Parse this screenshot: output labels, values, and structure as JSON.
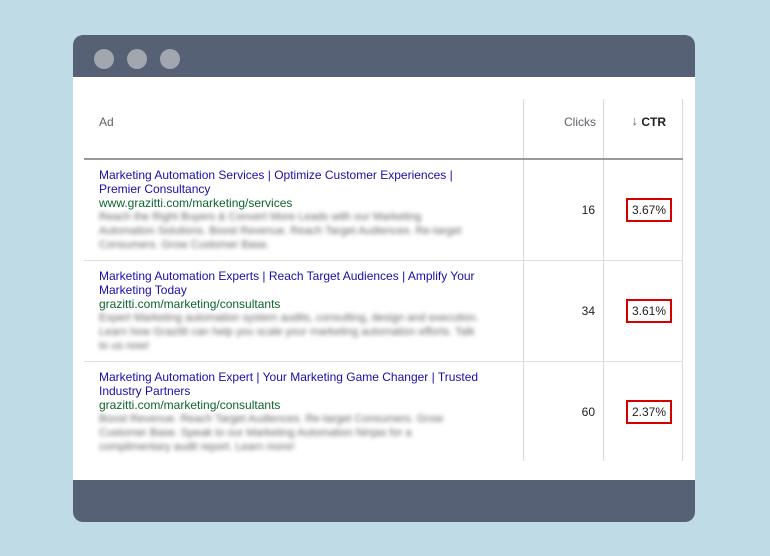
{
  "table": {
    "headers": {
      "ad": "Ad",
      "clicks": "Clicks",
      "ctr": "CTR"
    },
    "sort_icon": "arrow-down-icon",
    "rows": [
      {
        "title_line1": "Marketing Automation Services | Optimize Customer Experiences |",
        "title_line2": "Premier Consultancy",
        "url": "www.grazitti.com/marketing/services",
        "desc": "Reach the Right Buyers & Convert More Leads with our Marketing Automation Solutions. Boost Revenue. Reach Target Audiences. Re-target Consumers. Grow Customer Base.",
        "clicks": "16",
        "ctr": "3.67%"
      },
      {
        "title_line1": "Marketing Automation Experts | Reach Target Audiences | Amplify Your",
        "title_line2": "Marketing Today",
        "url": "grazitti.com/marketing/consultants",
        "desc": "Expert Marketing automation system audits, consulting, design and execution. Learn how Grazitti can help you scale your marketing automation efforts. Talk to us now!",
        "clicks": "34",
        "ctr": "3.61%"
      },
      {
        "title_line1": "Marketing Automation Expert | Your Marketing Game Changer | Trusted",
        "title_line2": "Industry Partners",
        "url": "grazitti.com/marketing/consultants",
        "desc": "Boost Revenue. Reach Target Audiences. Re-target Consumers. Grow Customer Base. Speak to our Marketing Automation Ninjas for a complimentary audit report. Learn more!",
        "clicks": "60",
        "ctr": "2.37%"
      }
    ]
  },
  "colors": {
    "background": "#bedbe6",
    "window_chrome": "#566176",
    "highlight_border": "#d60000",
    "ad_title": "#1a0dab",
    "ad_url": "#0d652d"
  }
}
